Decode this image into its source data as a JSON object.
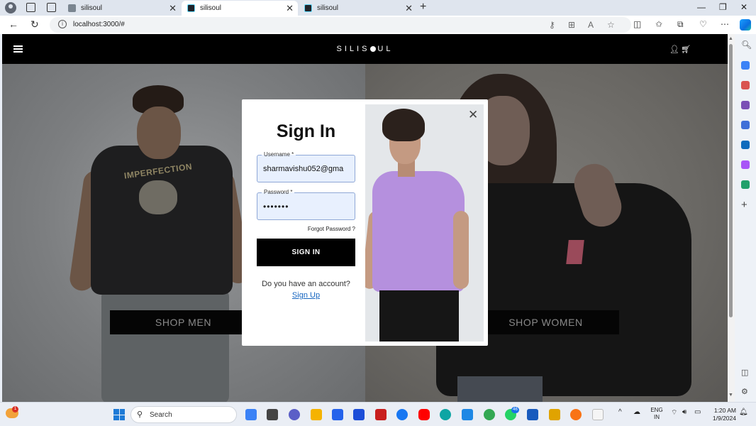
{
  "browser": {
    "tabs": [
      {
        "title": "silisoul",
        "active": false
      },
      {
        "title": "silisoul",
        "active": true
      },
      {
        "title": "silisoul",
        "active": false
      }
    ],
    "url": "localhost:3000/#"
  },
  "site": {
    "brand_left": "SILIS",
    "brand_right": "UL",
    "hero": {
      "men_print": "IMPERFECTION",
      "shop_men": "SHOP MEN",
      "shop_women": "SHOP WOMEN"
    }
  },
  "login": {
    "title": "Sign In",
    "username_label": "Username *",
    "username_value": "sharmavishu052@gma",
    "password_label": "Password *",
    "password_value": "•••••••",
    "forgot": "Forgot Password ?",
    "submit": "SIGN IN",
    "prompt": "Do you have an account?",
    "signup": "Sign Up",
    "close": "✕"
  },
  "taskbar": {
    "search": "Search",
    "weather_badge": "1",
    "badges": {
      "chrome": "",
      "whatsapp": "46"
    },
    "lang_line1": "ENG",
    "lang_line2": "IN",
    "time": "1:20 AM",
    "date": "1/9/2024"
  },
  "colors": {
    "header": "#000000",
    "field_bg": "#e8f0fe",
    "link": "#1565c0",
    "shirt_lavender": "#b590de"
  }
}
